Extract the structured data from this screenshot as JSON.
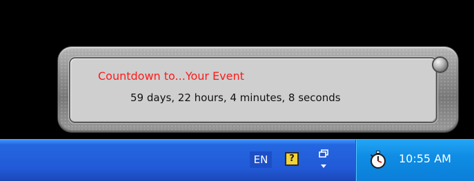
{
  "notification": {
    "title": "Countdown to...Your Event",
    "message": "59 days, 22 hours, 4 minutes, 8 seconds"
  },
  "taskbar": {
    "language": "EN",
    "help_icon_glyph": "?",
    "clock": "10:55 AM",
    "icons": [
      "help-icon",
      "restore-windows-icon",
      "stopwatch-icon"
    ]
  },
  "colors": {
    "title_red": "#ff1a1a",
    "taskbar_blue": "#2259d6",
    "tray_blue": "#0f8de4"
  }
}
